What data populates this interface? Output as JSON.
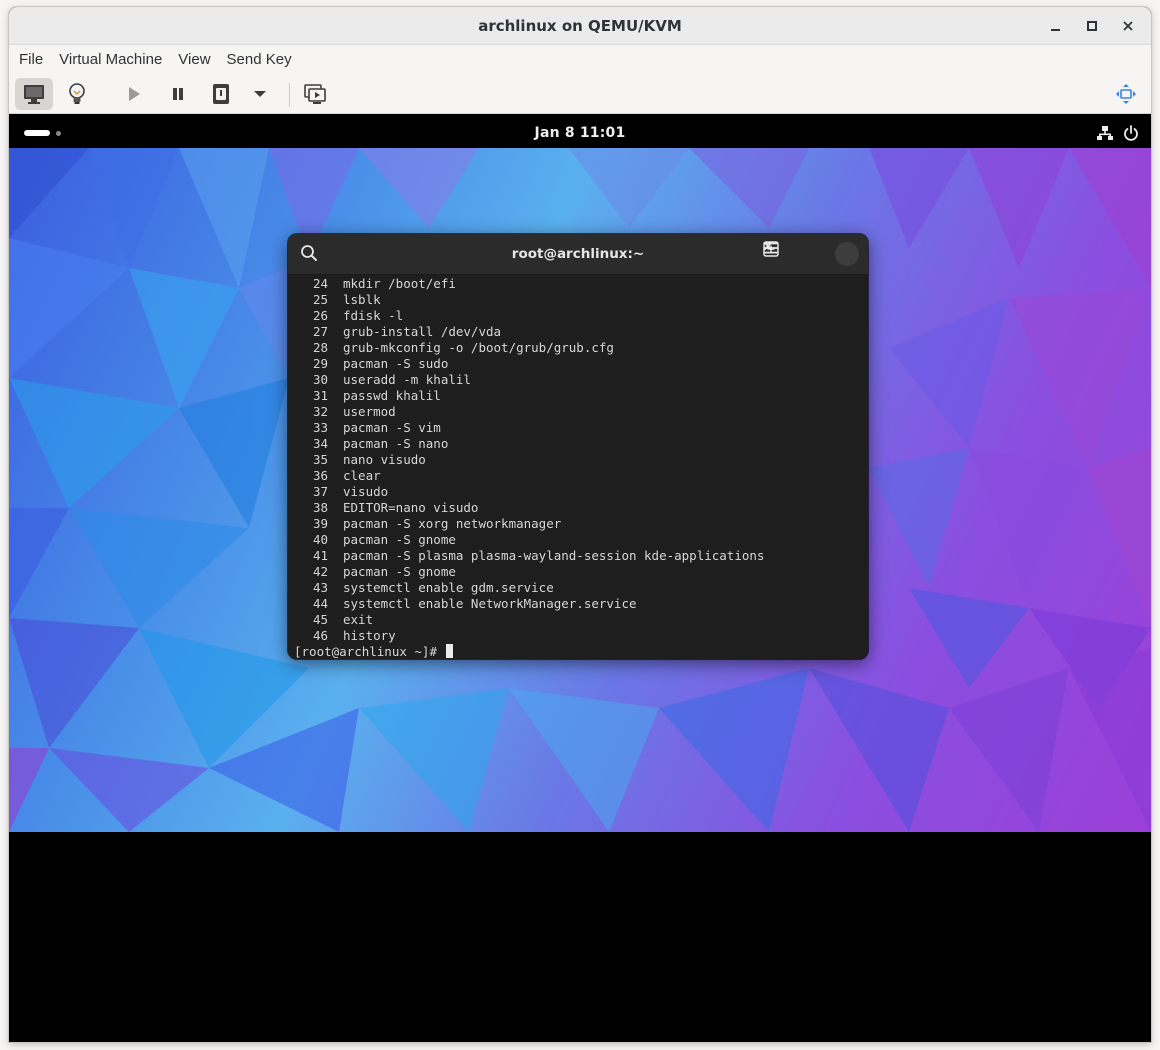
{
  "window": {
    "title": "archlinux on QEMU/KVM"
  },
  "menubar": {
    "items": [
      "File",
      "Virtual Machine",
      "View",
      "Send Key"
    ]
  },
  "gnome": {
    "clock": "Jan 8  11:01"
  },
  "terminal": {
    "title": "root@archlinux:~",
    "history": [
      {
        "n": "24",
        "cmd": "mkdir /boot/efi"
      },
      {
        "n": "25",
        "cmd": "lsblk"
      },
      {
        "n": "26",
        "cmd": "fdisk -l"
      },
      {
        "n": "27",
        "cmd": "grub-install /dev/vda"
      },
      {
        "n": "28",
        "cmd": "grub-mkconfig -o /boot/grub/grub.cfg"
      },
      {
        "n": "29",
        "cmd": "pacman -S sudo"
      },
      {
        "n": "30",
        "cmd": "useradd -m khalil"
      },
      {
        "n": "31",
        "cmd": "passwd khalil"
      },
      {
        "n": "32",
        "cmd": "usermod"
      },
      {
        "n": "33",
        "cmd": "pacman -S vim"
      },
      {
        "n": "34",
        "cmd": "pacman -S nano"
      },
      {
        "n": "35",
        "cmd": "nano visudo"
      },
      {
        "n": "36",
        "cmd": "clear"
      },
      {
        "n": "37",
        "cmd": "visudo"
      },
      {
        "n": "38",
        "cmd": "EDITOR=nano visudo"
      },
      {
        "n": "39",
        "cmd": "pacman -S xorg networkmanager"
      },
      {
        "n": "40",
        "cmd": "pacman -S gnome"
      },
      {
        "n": "41",
        "cmd": "pacman -S plasma plasma-wayland-session kde-applications"
      },
      {
        "n": "42",
        "cmd": "pacman -S gnome"
      },
      {
        "n": "43",
        "cmd": "systemctl enable gdm.service"
      },
      {
        "n": "44",
        "cmd": "systemctl enable NetworkManager.service"
      },
      {
        "n": "45",
        "cmd": "exit"
      },
      {
        "n": "46",
        "cmd": "history"
      }
    ],
    "prompt": "[root@archlinux ~]# "
  }
}
